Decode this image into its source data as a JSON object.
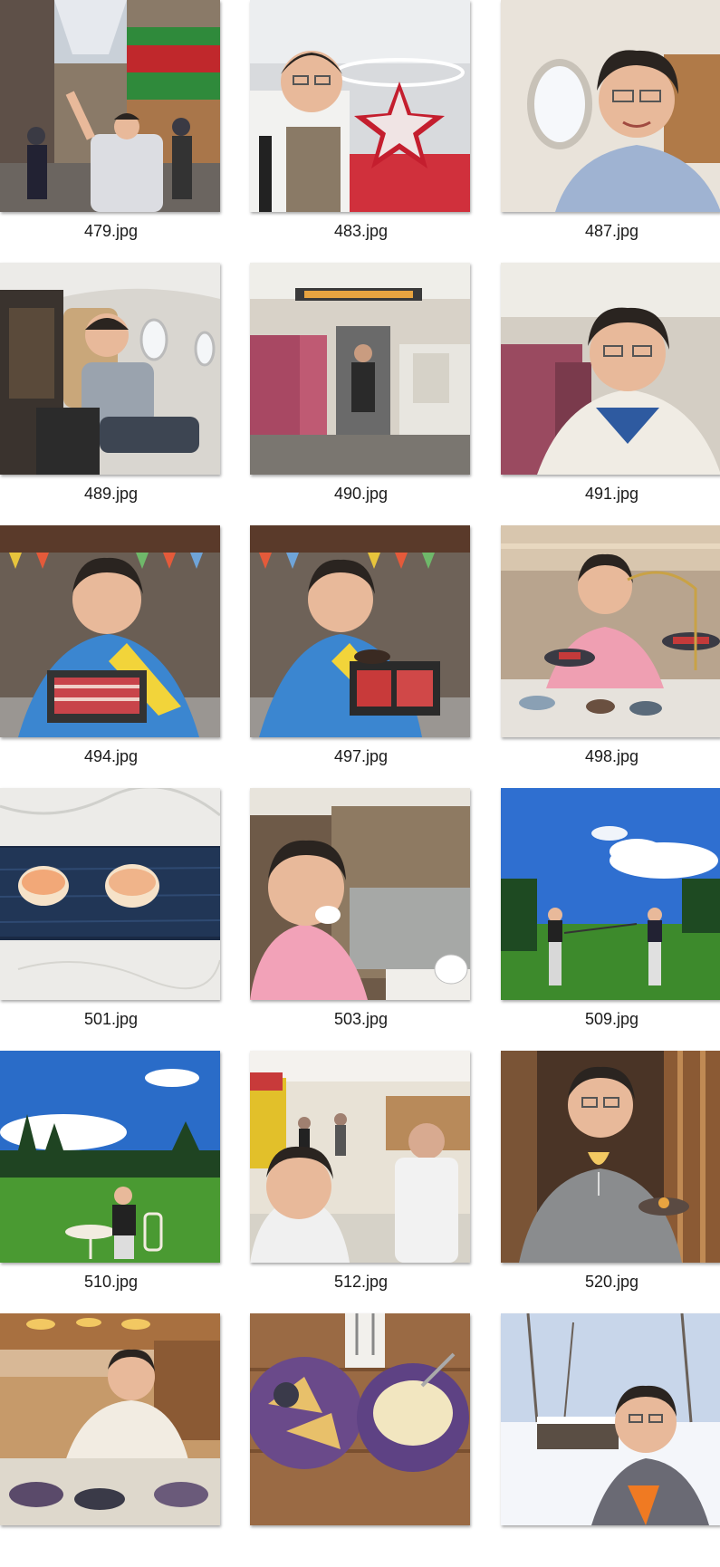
{
  "files": [
    {
      "name": "479.jpg",
      "scene": "shopping-arcade"
    },
    {
      "name": "483.jpg",
      "scene": "airport-star"
    },
    {
      "name": "487.jpg",
      "scene": "airplane-window"
    },
    {
      "name": "489.jpg",
      "scene": "airplane-seat"
    },
    {
      "name": "490.jpg",
      "scene": "train-aisle"
    },
    {
      "name": "491.jpg",
      "scene": "train-selfie"
    },
    {
      "name": "494.jpg",
      "scene": "restaurant-meat"
    },
    {
      "name": "497.jpg",
      "scene": "restaurant-meat-2"
    },
    {
      "name": "498.jpg",
      "scene": "restaurant-pink"
    },
    {
      "name": "501.jpg",
      "scene": "sushi-plate"
    },
    {
      "name": "503.jpg",
      "scene": "cafe-selfie"
    },
    {
      "name": "509.jpg",
      "scene": "golf-course"
    },
    {
      "name": "510.jpg",
      "scene": "golf-lawn"
    },
    {
      "name": "512.jpg",
      "scene": "crowded-shop"
    },
    {
      "name": "520.jpg",
      "scene": "wine-toast"
    },
    {
      "name": "",
      "scene": "buffet"
    },
    {
      "name": "",
      "scene": "food-plates"
    },
    {
      "name": "",
      "scene": "snow-park"
    }
  ],
  "colors": {
    "skin": "#e8b99a",
    "hair": "#2a2420",
    "sky": "#2f6fd0",
    "grass": "#3d8a2c",
    "wood": "#8b5a34"
  }
}
